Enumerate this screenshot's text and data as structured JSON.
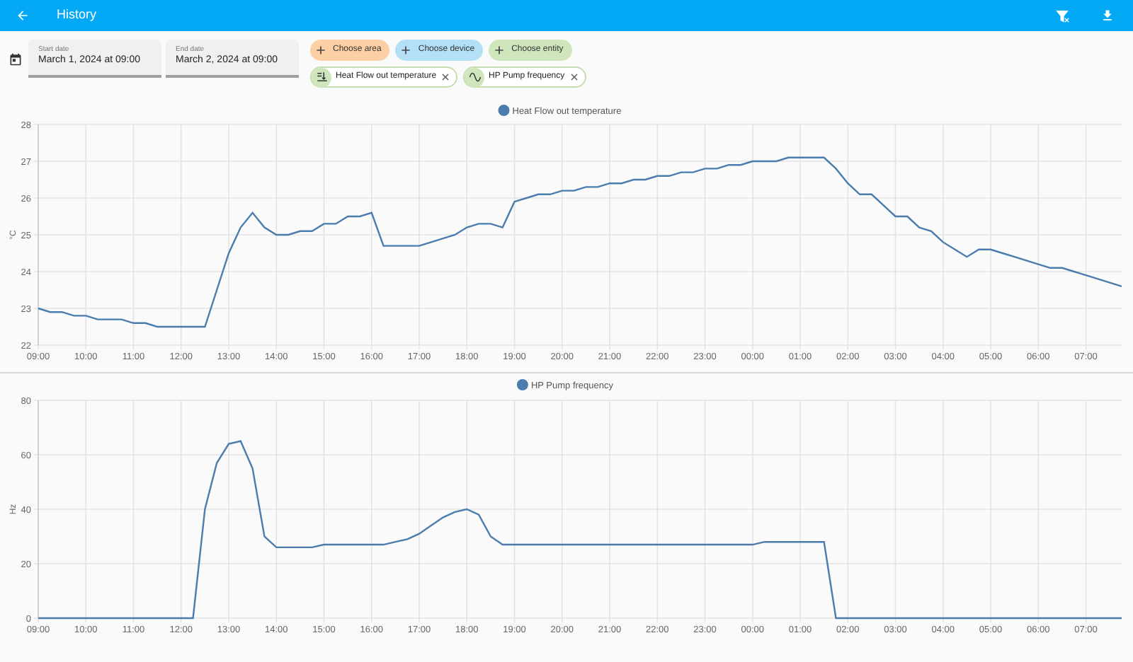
{
  "header": {
    "title": "History"
  },
  "date_fields": [
    {
      "label": "Start date",
      "value": "March 1, 2024 at 09:00"
    },
    {
      "label": "End date",
      "value": "March 2, 2024 at 09:00"
    }
  ],
  "pickers": [
    {
      "label": "Choose area",
      "color": "#fcd0a4"
    },
    {
      "label": "Choose device",
      "color": "#b3e0f7"
    },
    {
      "label": "Choose entity",
      "color": "#cfe6bc"
    }
  ],
  "entities": [
    {
      "kind": "temperature",
      "label": "Heat Flow out temperature"
    },
    {
      "kind": "wave",
      "label": "HP Pump frequency"
    }
  ],
  "charts": [
    {
      "chart_data": {
        "type": "line",
        "grid": true,
        "ylabel": "°C",
        "ylim": [
          22,
          28
        ],
        "yticks": [
          22,
          23,
          24,
          25,
          26,
          27,
          28
        ],
        "categories": [
          "09:00",
          null,
          null,
          null,
          "10:00",
          null,
          null,
          null,
          "11:00",
          null,
          null,
          null,
          "12:00",
          null,
          null,
          null,
          "13:00",
          null,
          null,
          null,
          "14:00",
          null,
          null,
          null,
          "15:00",
          null,
          null,
          null,
          "16:00",
          null,
          null,
          null,
          "17:00",
          null,
          null,
          null,
          "18:00",
          null,
          null,
          null,
          "19:00",
          null,
          null,
          null,
          "20:00",
          null,
          null,
          null,
          "21:00",
          null,
          null,
          null,
          "22:00",
          null,
          null,
          null,
          "23:00",
          null,
          null,
          null,
          "00:00",
          null,
          null,
          null,
          "01:00",
          null,
          null,
          null,
          "02:00",
          null,
          null,
          null,
          "03:00",
          null,
          null,
          null,
          "04:00",
          null,
          null,
          null,
          "05:00",
          null,
          null,
          null,
          "06:00",
          null,
          null,
          null,
          "07:00",
          null,
          null,
          null
        ],
        "series": [
          {
            "name": "Heat Flow out temperature",
            "color": "#4a7cad",
            "values": [
              23,
              22.9,
              22.9,
              22.8,
              22.8,
              22.7,
              22.7,
              22.7,
              22.6,
              22.6,
              22.5,
              22.5,
              22.5,
              22.5,
              22.5,
              23.5,
              24.5,
              25.2,
              25.6,
              25.2,
              25,
              25,
              25.1,
              25.1,
              25.3,
              25.3,
              25.5,
              25.5,
              25.6,
              24.7,
              24.7,
              24.7,
              24.7,
              24.8,
              24.9,
              25,
              25.2,
              25.3,
              25.3,
              25.2,
              25.9,
              26,
              26.1,
              26.1,
              26.2,
              26.2,
              26.3,
              26.3,
              26.4,
              26.4,
              26.5,
              26.5,
              26.6,
              26.6,
              26.7,
              26.7,
              26.8,
              26.8,
              26.9,
              26.9,
              27,
              27,
              27,
              27.1,
              27.1,
              27.1,
              27.1,
              26.8,
              26.4,
              26.1,
              26.1,
              25.8,
              25.5,
              25.5,
              25.2,
              25.1,
              24.8,
              24.6,
              24.4,
              24.6,
              24.6,
              24.5,
              24.4,
              24.3,
              24.2,
              24.1,
              24.1,
              24,
              23.9,
              23.8,
              23.7,
              23.6
            ]
          }
        ]
      }
    },
    {
      "chart_data": {
        "type": "line",
        "grid": true,
        "ylabel": "Hz",
        "ylim": [
          0,
          80
        ],
        "yticks": [
          0,
          20,
          40,
          60,
          80
        ],
        "categories": [
          "09:00",
          null,
          null,
          null,
          "10:00",
          null,
          null,
          null,
          "11:00",
          null,
          null,
          null,
          "12:00",
          null,
          null,
          null,
          "13:00",
          null,
          null,
          null,
          "14:00",
          null,
          null,
          null,
          "15:00",
          null,
          null,
          null,
          "16:00",
          null,
          null,
          null,
          "17:00",
          null,
          null,
          null,
          "18:00",
          null,
          null,
          null,
          "19:00",
          null,
          null,
          null,
          "20:00",
          null,
          null,
          null,
          "21:00",
          null,
          null,
          null,
          "22:00",
          null,
          null,
          null,
          "23:00",
          null,
          null,
          null,
          "00:00",
          null,
          null,
          null,
          "01:00",
          null,
          null,
          null,
          "02:00",
          null,
          null,
          null,
          "03:00",
          null,
          null,
          null,
          "04:00",
          null,
          null,
          null,
          "05:00",
          null,
          null,
          null,
          "06:00",
          null,
          null,
          null,
          "07:00",
          null,
          null,
          null
        ],
        "series": [
          {
            "name": "HP Pump frequency",
            "color": "#4a7cad",
            "values": [
              0,
              0,
              0,
              0,
              0,
              0,
              0,
              0,
              0,
              0,
              0,
              0,
              0,
              0,
              40,
              57,
              64,
              65,
              55,
              30,
              26,
              26,
              26,
              26,
              27,
              27,
              27,
              27,
              27,
              27,
              28,
              29,
              31,
              34,
              37,
              39,
              40,
              38,
              30,
              27,
              27,
              27,
              27,
              27,
              27,
              27,
              27,
              27,
              27,
              27,
              27,
              27,
              27,
              27,
              27,
              27,
              27,
              27,
              27,
              27,
              27,
              28,
              28,
              28,
              28,
              28,
              28,
              0,
              0,
              0,
              0,
              0,
              0,
              0,
              0,
              0,
              0,
              0,
              0,
              0,
              0,
              0,
              0,
              0,
              0,
              0,
              0,
              0,
              0,
              0,
              0,
              0
            ]
          }
        ]
      }
    }
  ]
}
